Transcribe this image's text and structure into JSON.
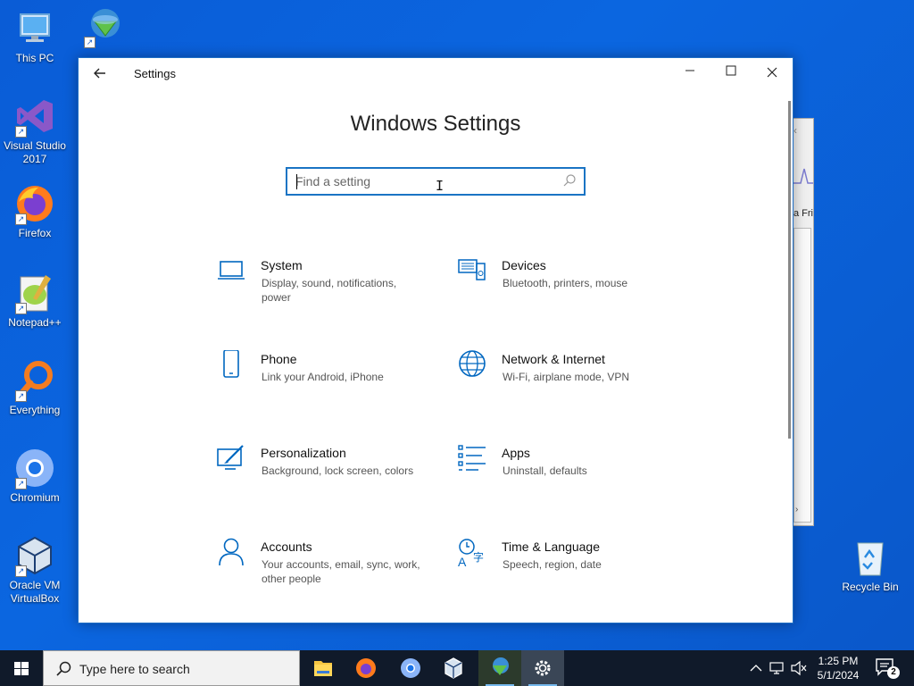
{
  "desktop": {
    "icons": [
      {
        "label": "This PC",
        "icon": "this-pc-icon"
      },
      {
        "label": "Visual Studio 2017",
        "icon": "visual-studio-icon"
      },
      {
        "label": "Firefox",
        "icon": "firefox-icon"
      },
      {
        "label": "Notepad++",
        "icon": "notepadpp-icon"
      },
      {
        "label": "Everything",
        "icon": "everything-icon"
      },
      {
        "label": "Chromium",
        "icon": "chromium-icon"
      },
      {
        "label": "Oracle VM VirtualBox",
        "icon": "virtualbox-icon"
      },
      {
        "label": "",
        "icon": "internet-download-manager-icon"
      }
    ],
    "recycle_bin": "Recycle Bin",
    "bg_window_fragment": "a Fri"
  },
  "window": {
    "title": "Settings",
    "minimize": "—",
    "maximize": "☐",
    "close": "✕"
  },
  "main": {
    "heading": "Windows Settings",
    "search_placeholder": "Find a setting",
    "tiles": [
      {
        "name": "System",
        "desc": "Display, sound, notifications, power",
        "icon": "laptop-icon"
      },
      {
        "name": "Devices",
        "desc": "Bluetooth, printers, mouse",
        "icon": "devices-icon"
      },
      {
        "name": "Phone",
        "desc": "Link your Android, iPhone",
        "icon": "phone-icon"
      },
      {
        "name": "Network & Internet",
        "desc": "Wi-Fi, airplane mode, VPN",
        "icon": "globe-icon"
      },
      {
        "name": "Personalization",
        "desc": "Background, lock screen, colors",
        "icon": "personalization-icon"
      },
      {
        "name": "Apps",
        "desc": "Uninstall, defaults",
        "icon": "apps-list-icon"
      },
      {
        "name": "Accounts",
        "desc": "Your accounts, email, sync, work, other people",
        "icon": "person-icon"
      },
      {
        "name": "Time & Language",
        "desc": "Speech, region, date",
        "icon": "time-language-icon"
      }
    ]
  },
  "taskbar": {
    "search_placeholder": "Type here to search",
    "apps": [
      "file-explorer",
      "firefox",
      "chromium",
      "virtualbox",
      "internet-download-manager",
      "settings"
    ],
    "time": "1:25 PM",
    "date": "5/1/2024",
    "notification_count": "2"
  },
  "colors": {
    "accent": "#0067c0",
    "desktop": "#0b61da",
    "taskbar": "#101a2a"
  }
}
